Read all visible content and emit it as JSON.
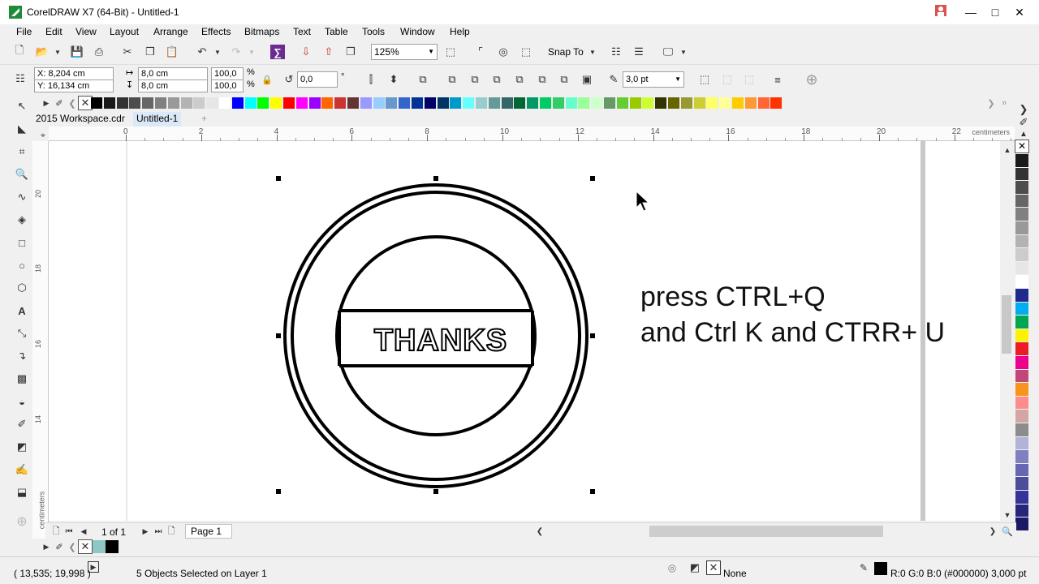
{
  "window": {
    "title": "CorelDRAW X7 (64-Bit) - Untitled-1"
  },
  "menu": [
    "File",
    "Edit",
    "View",
    "Layout",
    "Arrange",
    "Effects",
    "Bitmaps",
    "Text",
    "Table",
    "Tools",
    "Window",
    "Help"
  ],
  "toolbar": {
    "zoom": "125%",
    "snap_to": "Snap To"
  },
  "properties": {
    "x": "X: 8,204 cm",
    "y": "Y: 16,134 cm",
    "width": "8,0 cm",
    "height": "8,0 cm",
    "scale_w": "100,0",
    "scale_h": "100,0",
    "percent_sign": "%",
    "rotation": "0,0",
    "degree_sign": "°",
    "outline": "3,0 pt"
  },
  "doc_tabs": [
    "2015 Workspace.cdr",
    "Untitled-1"
  ],
  "ruler": {
    "h_ticks": [
      "0",
      "2",
      "4",
      "6",
      "8",
      "10",
      "12",
      "14",
      "16",
      "18",
      "20",
      "22"
    ],
    "unit": "centimeters",
    "v_ticks": [
      "20",
      "18",
      "16",
      "14"
    ]
  },
  "canvas": {
    "stamp_text": "THANKS",
    "note_line1": "press CTRL+Q",
    "note_line2": "and Ctrl K and CTRR+ U"
  },
  "pagebar": {
    "page_count": "1 of 1",
    "page_tab": "Page 1"
  },
  "status": {
    "cursor": "( 13,535; 19,998 )",
    "selection": "5 Objects Selected on Layer 1",
    "fill": "None",
    "outline": "R:0 G:0 B:0 (#000000)  3,000 pt"
  },
  "palette_top": [
    "#000000",
    "#1a1a1a",
    "#333333",
    "#4d4d4d",
    "#666666",
    "#808080",
    "#999999",
    "#b3b3b3",
    "#cccccc",
    "#e6e6e6",
    "#ffffff",
    "#0000ff",
    "#00ffff",
    "#00ff00",
    "#ffff00",
    "#ff0000",
    "#ff00ff",
    "#9900ff",
    "#ff6600",
    "#cc3333",
    "#663333",
    "#9999ff",
    "#99ccff",
    "#6699cc",
    "#3366cc",
    "#003399",
    "#000066",
    "#003366",
    "#0099cc",
    "#66ffff",
    "#99cccc",
    "#669999",
    "#336666",
    "#006633",
    "#009966",
    "#00cc66",
    "#33cc66",
    "#66ffcc",
    "#99ff99",
    "#ccffcc",
    "#669966",
    "#66cc33",
    "#99cc00",
    "#ccff33",
    "#333300",
    "#666600",
    "#999933",
    "#cccc33",
    "#ffff66",
    "#ffff99",
    "#ffcc00",
    "#ff9933",
    "#ff6633",
    "#ff3300"
  ],
  "palette_right": [
    "#1a1a1a",
    "#333333",
    "#4d4d4d",
    "#666666",
    "#808080",
    "#999999",
    "#b3b3b3",
    "#cccccc",
    "#e6e6e6",
    "#ffffff",
    "#1f2a8c",
    "#00aeef",
    "#00a651",
    "#fff200",
    "#ed1c24",
    "#ec008c",
    "#c1467a",
    "#f7941d",
    "#ff8c8c",
    "#d4a5a5",
    "#8c8c8c",
    "#b3b3d9",
    "#8080c0",
    "#6666b3",
    "#4d4d99",
    "#333399",
    "#26267a",
    "#1a1a66"
  ]
}
